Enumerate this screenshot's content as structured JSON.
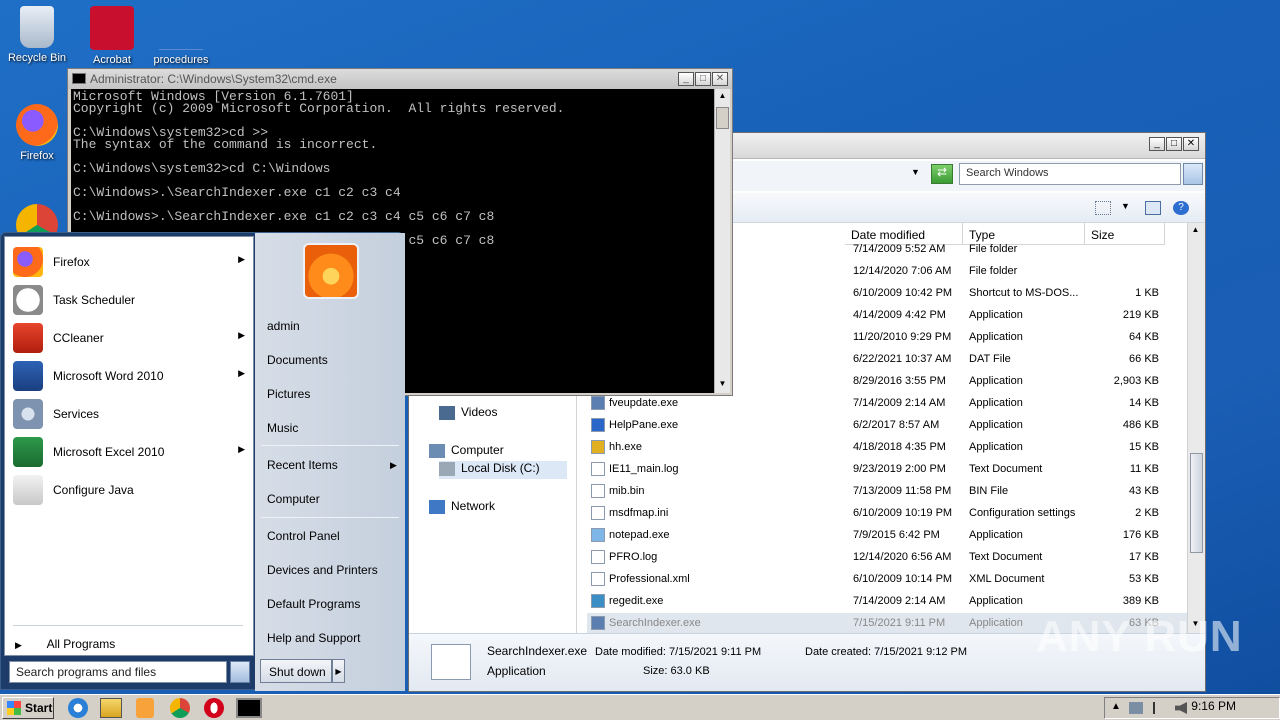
{
  "desktop": {
    "icons": [
      {
        "label": "Recycle Bin",
        "icon": "recycle-bin-icon"
      },
      {
        "label": "Acrobat",
        "icon": "acrobat-icon"
      },
      {
        "label": "procedures",
        "icon": "folder-icon"
      },
      {
        "label": "Firefox",
        "icon": "firefox-icon"
      }
    ]
  },
  "cmd": {
    "title": "Administrator: C:\\Windows\\System32\\cmd.exe",
    "lines": [
      "Microsoft Windows [Version 6.1.7601]",
      "Copyright (c) 2009 Microsoft Corporation.  All rights reserved.",
      "",
      "C:\\Windows\\system32>cd >>",
      "The syntax of the command is incorrect.",
      "",
      "C:\\Windows\\system32>cd C:\\Windows",
      "",
      "C:\\Windows>.\\SearchIndexer.exe c1 c2 c3 c4",
      "",
      "C:\\Windows>.\\SearchIndexer.exe c1 c2 c3 c4 c5 c6 c7 c8",
      "",
      "C:\\Windows>.\\SearchIndexer.exe c1 c2 c3 c4 c5 c6 c7 c8"
    ]
  },
  "explorer": {
    "search_placeholder": "Search Windows",
    "columns": {
      "date": "Date modified",
      "type": "Type",
      "size": "Size"
    },
    "nav": {
      "videos": "Videos",
      "computer": "Computer",
      "local_disk": "Local Disk (C:)",
      "network": "Network"
    },
    "rows": [
      {
        "name": "",
        "date": "7/14/2009 5:52 AM",
        "type": "File folder",
        "size": ""
      },
      {
        "name": "",
        "date": "12/14/2020 7:06 AM",
        "type": "File folder",
        "size": ""
      },
      {
        "name": "",
        "date": "6/10/2009 10:42 PM",
        "type": "Shortcut to MS-DOS...",
        "size": "1 KB"
      },
      {
        "name": "",
        "date": "4/14/2009 4:42 PM",
        "type": "Application",
        "size": "219 KB"
      },
      {
        "name": "",
        "date": "11/20/2010 9:29 PM",
        "type": "Application",
        "size": "64 KB"
      },
      {
        "name": "",
        "date": "6/22/2021 10:37 AM",
        "type": "DAT File",
        "size": "66 KB"
      },
      {
        "name": "",
        "date": "8/29/2016 3:55 PM",
        "type": "Application",
        "size": "2,903 KB"
      },
      {
        "name": "fveupdate.exe",
        "date": "7/14/2009 2:14 AM",
        "type": "Application",
        "size": "14 KB"
      },
      {
        "name": "HelpPane.exe",
        "date": "6/2/2017 8:57 AM",
        "type": "Application",
        "size": "486 KB"
      },
      {
        "name": "hh.exe",
        "date": "4/18/2018 4:35 PM",
        "type": "Application",
        "size": "15 KB"
      },
      {
        "name": "IE11_main.log",
        "date": "9/23/2019 2:00 PM",
        "type": "Text Document",
        "size": "11 KB"
      },
      {
        "name": "mib.bin",
        "date": "7/13/2009 11:58 PM",
        "type": "BIN File",
        "size": "43 KB"
      },
      {
        "name": "msdfmap.ini",
        "date": "6/10/2009 10:19 PM",
        "type": "Configuration settings",
        "size": "2 KB"
      },
      {
        "name": "notepad.exe",
        "date": "7/9/2015 6:42 PM",
        "type": "Application",
        "size": "176 KB"
      },
      {
        "name": "PFRO.log",
        "date": "12/14/2020 6:56 AM",
        "type": "Text Document",
        "size": "17 KB"
      },
      {
        "name": "Professional.xml",
        "date": "6/10/2009 10:14 PM",
        "type": "XML Document",
        "size": "53 KB"
      },
      {
        "name": "regedit.exe",
        "date": "7/14/2009 2:14 AM",
        "type": "Application",
        "size": "389 KB"
      },
      {
        "name": "SearchIndexer.exe",
        "date": "7/15/2021 9:11 PM",
        "type": "Application",
        "size": "63 KB"
      }
    ],
    "details": {
      "name": "SearchIndexer.exe",
      "kind": "Application",
      "modified": "Date modified: 7/15/2021 9:11 PM",
      "created": "Date created: 7/15/2021 9:12 PM",
      "size": "Size: 63.0 KB"
    }
  },
  "startmenu": {
    "programs": [
      {
        "label": "Firefox",
        "icon": "firefox-icon",
        "arrow": true
      },
      {
        "label": "Task Scheduler",
        "icon": "clock-icon",
        "arrow": false
      },
      {
        "label": "CCleaner",
        "icon": "ccleaner-icon",
        "arrow": true
      },
      {
        "label": "Microsoft Word 2010",
        "icon": "word-icon",
        "arrow": true
      },
      {
        "label": "Services",
        "icon": "gear-icon",
        "arrow": false
      },
      {
        "label": "Microsoft Excel 2010",
        "icon": "excel-icon",
        "arrow": true
      },
      {
        "label": "Configure Java",
        "icon": "java-icon",
        "arrow": false
      }
    ],
    "all_programs": "All Programs",
    "search_placeholder": "Search programs and files",
    "right_links": {
      "user": "admin",
      "documents": "Documents",
      "pictures": "Pictures",
      "music": "Music",
      "recent": "Recent Items",
      "computer": "Computer",
      "control_panel": "Control Panel",
      "devices": "Devices and Printers",
      "default_programs": "Default Programs",
      "help": "Help and Support"
    },
    "shutdown": "Shut down"
  },
  "taskbar": {
    "start": "Start",
    "clock": "9:16 PM",
    "pinned": [
      "ie-icon",
      "explorer-icon",
      "media-player-icon",
      "chrome-icon",
      "opera-icon",
      "cmd-icon"
    ]
  },
  "watermark": "ANY RUN"
}
